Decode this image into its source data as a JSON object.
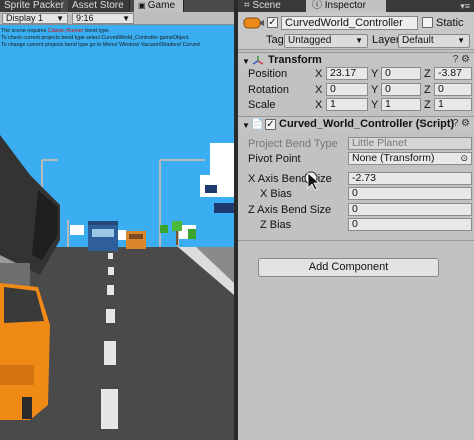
{
  "left_tabs": [
    "Sprite Packer",
    "Asset Store",
    "Game"
  ],
  "game_toolbar": {
    "display": "Display 1",
    "aspect": "9:16"
  },
  "game_messages": {
    "line1_prefix": "The scene requires ",
    "line1_red": "Classic Runner",
    "line1_suffix": " bend type.",
    "line2": "To check current projects bend type select CurvedWorld_Controller gameObject.",
    "line3": "To change current projects bend type go to Menu/ Window/ VacuumShaders/ Curved"
  },
  "right_tabs": {
    "scene": "Scene",
    "inspector": "Inspector"
  },
  "gameobject": {
    "name": "CurvedWorld_Controller",
    "static_label": "Static",
    "tag_label": "Tag",
    "tag_value": "Untagged",
    "layer_label": "Layer",
    "layer_value": "Default"
  },
  "transform": {
    "title": "Transform",
    "position_label": "Position",
    "rotation_label": "Rotation",
    "scale_label": "Scale",
    "axes": [
      "X",
      "Y",
      "Z"
    ],
    "position": [
      "23.17",
      "0",
      "-3.87"
    ],
    "rotation": [
      "0",
      "0",
      "0"
    ],
    "scale": [
      "1",
      "1",
      "1"
    ]
  },
  "script_component": {
    "title": "Curved_World_Controller (Script)",
    "project_bend_type_label": "Project Bend Type",
    "project_bend_type_value": "Little Planet",
    "pivot_point_label": "Pivot Point",
    "pivot_point_value": "None (Transform)",
    "x_axis_bend_size_label": "X Axis Bend Size",
    "x_axis_bend_size_value": "-2.73",
    "x_bias_label": "X Bias",
    "x_bias_value": "0",
    "z_axis_bend_size_label": "Z Axis Bend Size",
    "z_axis_bend_size_value": "0",
    "z_bias_label": "Z Bias",
    "z_bias_value": "0"
  },
  "add_component_label": "Add Component",
  "colors": {
    "inspector_bg": "#c2c2c2",
    "sky": "#3aaef0",
    "road": "#4a4a4a",
    "warning_red": "#d01010"
  }
}
